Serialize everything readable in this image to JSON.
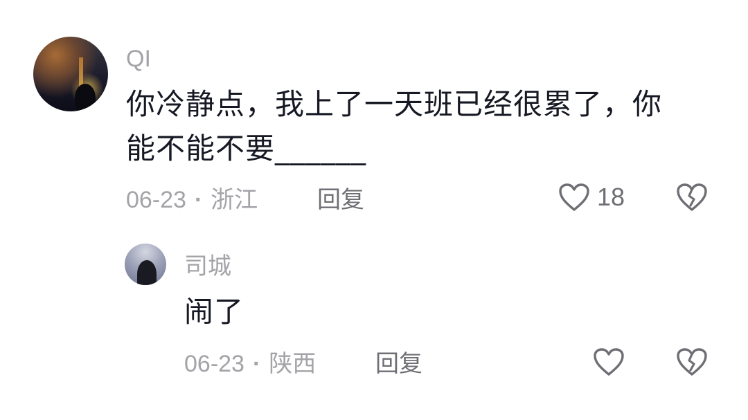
{
  "comments": [
    {
      "username": "QI",
      "text_line1": "你冷静点，我上了一天班已经很累了，你",
      "text_line2": "能不能不要______",
      "date": "06-23",
      "separator": "·",
      "location": "浙江",
      "reply_label": "回复",
      "likes": "18"
    },
    {
      "username": "司城",
      "text": "闹了",
      "date": "06-23",
      "separator": "·",
      "location": "陕西",
      "reply_label": "回复",
      "likes": ""
    }
  ],
  "icons": {
    "like": "heart-outline-icon",
    "dislike": "broken-heart-icon"
  },
  "colors": {
    "text_primary": "#161823",
    "text_secondary": "#a3a3a8",
    "icon": "#6e6e74",
    "background": "#ffffff"
  }
}
